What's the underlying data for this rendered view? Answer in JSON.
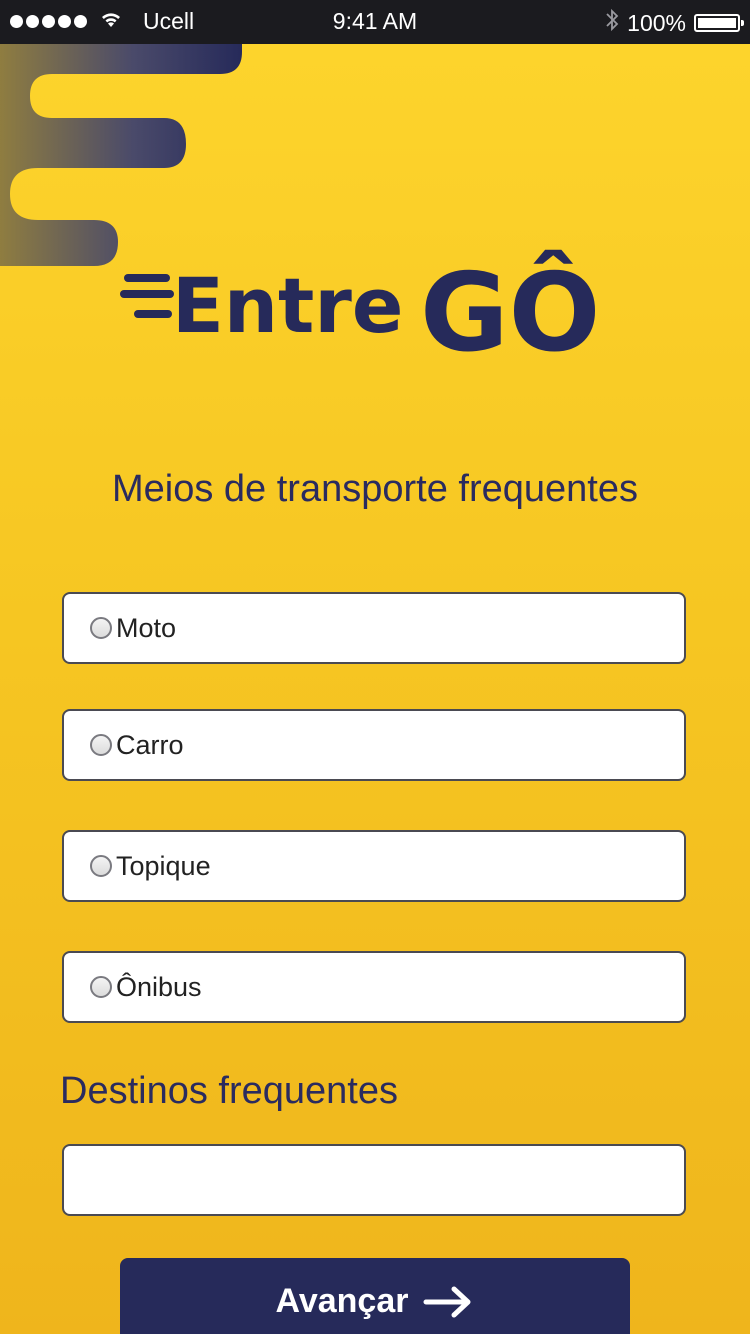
{
  "status": {
    "carrier": "Ucell",
    "time": "9:41 AM",
    "battery": "100%",
    "icons": [
      "signal-dots",
      "wifi-icon",
      "bluetooth-icon",
      "battery-icon"
    ]
  },
  "brand": {
    "name": "EntreGÔ",
    "color_primary": "#262a5a",
    "color_background": "#f6c622"
  },
  "transport": {
    "title": "Meios de transporte frequentes",
    "options": [
      {
        "label": "Moto",
        "selected": false
      },
      {
        "label": "Carro",
        "selected": false
      },
      {
        "label": "Topique",
        "selected": false
      },
      {
        "label": "Ônibus",
        "selected": false
      }
    ]
  },
  "destinos": {
    "title": "Destinos frequentes",
    "value": "",
    "placeholder": ""
  },
  "button": {
    "label": "Avançar",
    "icon": "arrow-right-icon"
  }
}
